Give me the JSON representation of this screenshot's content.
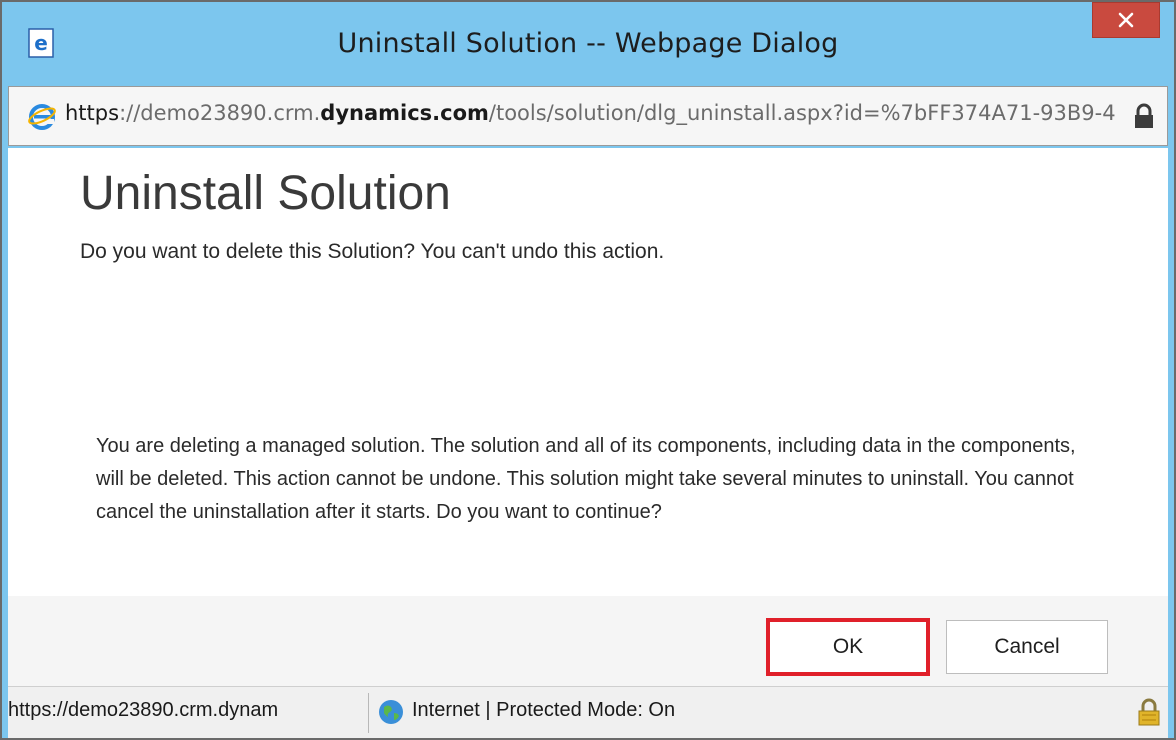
{
  "window": {
    "title": "Uninstall Solution -- Webpage Dialog",
    "close_label": "×"
  },
  "address_bar": {
    "url_scheme": "https",
    "url_colon_slashes": "://",
    "url_sub": "demo23890.crm.",
    "url_domain": "dynamics.com",
    "url_path": "/tools/solution/dlg_uninstall.aspx?id=%7bFF374A71-93B9-4"
  },
  "content": {
    "title": "Uninstall Solution",
    "subtitle": "Do you want to delete this Solution? You can't undo this action.",
    "warning": "You are deleting a managed solution. The solution and all of its components, including data in the components, will be deleted. This action cannot be undone. This solution might take several minutes to uninstall. You cannot cancel the uninstallation after it starts. Do you want to continue?"
  },
  "buttons": {
    "ok_label": "OK",
    "cancel_label": "Cancel"
  },
  "status_bar": {
    "url": "https://demo23890.crm.dynam",
    "zone": "Internet | Protected Mode: On"
  },
  "colors": {
    "titlebar": "#7cc6ee",
    "close_button": "#c94a3f",
    "ok_highlight": "#e0202a"
  },
  "icons": {
    "title_icon": "ie-icon",
    "address_icon": "ie-icon",
    "address_lock": "lock-icon",
    "status_globe": "globe-icon",
    "status_lock": "lock-icon"
  }
}
